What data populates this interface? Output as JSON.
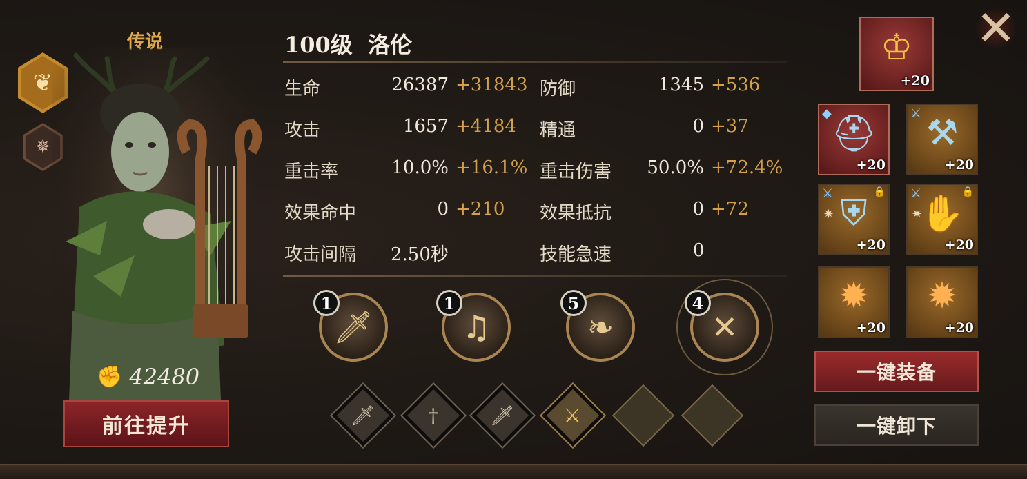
{
  "hero": {
    "rarity": "传说",
    "level_name": "100级  洛伦",
    "power": "42480",
    "upgrade_button": "前往提升"
  },
  "stats": [
    {
      "label": "生命",
      "base": "26387",
      "bonus": "+31843"
    },
    {
      "label": "防御",
      "base": "1345",
      "bonus": "+536"
    },
    {
      "label": "攻击",
      "base": "1657",
      "bonus": "+4184"
    },
    {
      "label": "精通",
      "base": "0",
      "bonus": "+37"
    },
    {
      "label": "重击率",
      "base": "10.0%",
      "bonus": "+16.1%"
    },
    {
      "label": "重击伤害",
      "base": "50.0%",
      "bonus": "+72.4%"
    },
    {
      "label": "效果命中",
      "base": "0",
      "bonus": "+210"
    },
    {
      "label": "效果抵抗",
      "base": "0",
      "bonus": "+72"
    },
    {
      "label": "攻击间隔",
      "base": "2.50秒",
      "bonus": ""
    },
    {
      "label": "技能急速",
      "base": "0",
      "bonus": ""
    }
  ],
  "skills": [
    {
      "level": "1",
      "icon": "flaming-sword-icon"
    },
    {
      "level": "1",
      "icon": "lyre-icon"
    },
    {
      "level": "5",
      "icon": "spirit-icon"
    },
    {
      "level": "4",
      "icon": "crossed-blades-icon"
    }
  ],
  "runes": [
    {
      "state": "filled",
      "icon": "sword-icon"
    },
    {
      "state": "filled",
      "icon": "planted-sword-icon"
    },
    {
      "state": "filled",
      "icon": "sword-icon"
    },
    {
      "state": "gold",
      "icon": "crossed-swords-icon"
    },
    {
      "state": "empty",
      "icon": ""
    },
    {
      "state": "empty",
      "icon": ""
    }
  ],
  "equipment": {
    "accessory": {
      "level": "+20",
      "icon": "antler-crown-icon"
    },
    "helmet": {
      "level": "+20",
      "icon": "helmet-icon"
    },
    "weapon": {
      "level": "+20",
      "icon": "axe-icon"
    },
    "armor": {
      "level": "+20",
      "icon": "chest-armor-icon"
    },
    "gloves": {
      "level": "+20",
      "icon": "gauntlet-icon"
    },
    "gem_1": {
      "level": "+20",
      "icon": "amber-gem-icon"
    },
    "gem_2": {
      "level": "+20",
      "icon": "amber-gem-icon"
    }
  },
  "buttons": {
    "equip_all": "一键装备",
    "unequip_all": "一键卸下"
  },
  "colors": {
    "bonus": "#d4a04a",
    "rarity": "#e0a94a",
    "primary_button": "#8c2429"
  }
}
